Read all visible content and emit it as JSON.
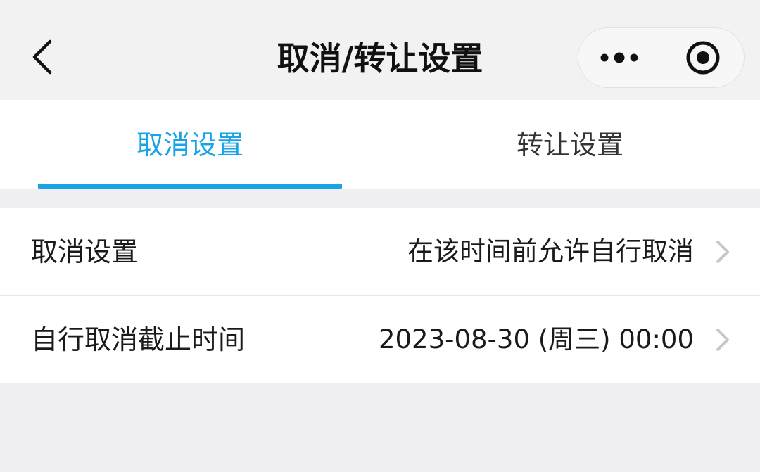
{
  "nav": {
    "title": "取消/转让设置",
    "back_icon": "chevron-left-icon",
    "more_icon": "more-dots-icon",
    "close_icon": "target-circle-icon"
  },
  "tabs": [
    {
      "label": "取消设置",
      "active": true
    },
    {
      "label": "转让设置",
      "active": false
    }
  ],
  "settings": [
    {
      "label": "取消设置",
      "value": "在该时间前允许自行取消"
    },
    {
      "label": "自行取消截止时间",
      "value": "2023-08-30 (周三) 00:00"
    }
  ],
  "colors": {
    "accent": "#1aa3e6",
    "page_background": "#efeff4",
    "nav_background": "#f2f2f2",
    "text_primary": "#1a1a1a",
    "chevron": "#c7c7cc"
  }
}
